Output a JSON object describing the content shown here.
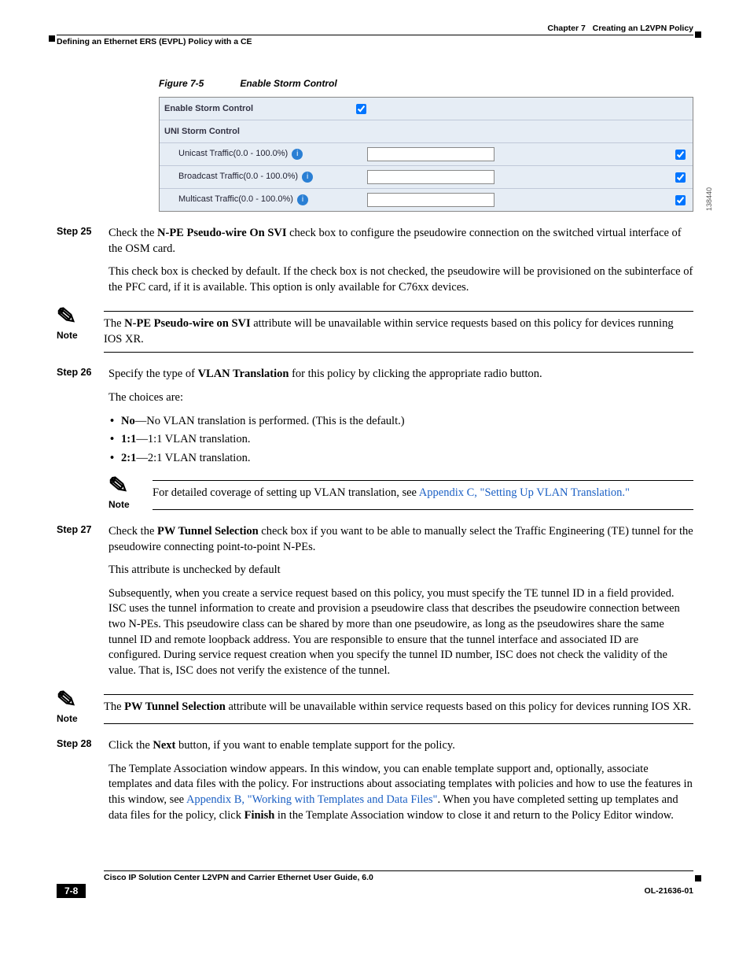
{
  "header": {
    "chapter_label": "Chapter 7",
    "chapter_title": "Creating an L2VPN Policy",
    "section": "Defining an Ethernet ERS (EVPL) Policy with a CE"
  },
  "figure": {
    "number": "Figure 7-5",
    "title": "Enable Storm Control",
    "side_code": "138440",
    "rows": {
      "enable_label": "Enable Storm Control",
      "uni_label": "UNI Storm Control",
      "unicast": "Unicast Traffic(0.0 - 100.0%)",
      "broadcast": "Broadcast Traffic(0.0 - 100.0%)",
      "multicast": "Multicast Traffic(0.0 - 100.0%)"
    }
  },
  "steps": {
    "s25": {
      "label": "Step 25",
      "p1a": "Check the ",
      "p1b": "N-PE Pseudo-wire On SVI",
      "p1c": " check box to configure the pseudowire connection on the switched virtual interface of the OSM card.",
      "p2": "This check box is checked by default. If the check box is not checked, the pseudowire will be provisioned on the subinterface of the PFC card, if it is available. This option is only available for C76xx devices."
    },
    "note1": {
      "label": "Note",
      "t1": "The ",
      "b1": "N-PE Pseudo-wire on SVI",
      "t2": " attribute will be unavailable within service requests based on this policy for devices running IOS XR."
    },
    "s26": {
      "label": "Step 26",
      "p1a": "Specify the type of ",
      "p1b": "VLAN Translation",
      "p1c": " for this policy by clicking the appropriate radio button.",
      "p2": "The choices are:",
      "b1a": "No",
      "b1b": "—No VLAN translation is performed. (This is the default.)",
      "b2a": "1:1",
      "b2b": "—1:1 VLAN translation.",
      "b3a": "2:1",
      "b3b": "—2:1 VLAN translation."
    },
    "note2": {
      "label": "Note",
      "t1": "For detailed coverage of setting up VLAN translation, see ",
      "link": "Appendix C, \"Setting Up VLAN Translation.\""
    },
    "s27": {
      "label": "Step 27",
      "p1a": "Check the ",
      "p1b": "PW Tunnel Selection",
      "p1c": " check box if you want to be able to manually select the Traffic Engineering (TE) tunnel for the pseudowire connecting point-to-point N-PEs.",
      "p2": "This attribute is unchecked by default",
      "p3": "Subsequently, when you create a service request based on this policy, you must specify the TE tunnel ID in a field provided. ISC uses the tunnel information to create and provision a pseudowire class that describes the pseudowire connection between two N-PEs. This pseudowire class can be shared by more than one pseudowire, as long as the pseudowires share the same tunnel ID and remote loopback address. You are responsible to ensure that the tunnel interface and associated ID are configured. During service request creation when you specify the tunnel ID number, ISC does not check the validity of the value. That is, ISC does not verify the existence of the tunnel."
    },
    "note3": {
      "label": "Note",
      "t1": "The ",
      "b1": "PW Tunnel Selection",
      "t2": " attribute will be unavailable within service requests based on this policy for devices running IOS XR."
    },
    "s28": {
      "label": "Step 28",
      "p1a": "Click the ",
      "p1b": "Next",
      "p1c": " button, if you want to enable template support for the policy.",
      "p2a": "The Template Association window appears. In this window, you can enable template support and, optionally, associate templates and data files with the policy. For instructions about associating templates with policies and how to use the features in this window, see ",
      "link": "Appendix B, \"Working with Templates and Data Files\"",
      "p2b": ". When you have completed setting up templates and data files for the policy, click ",
      "b2": "Finish",
      "p2c": " in the Template Association window to close it and return to the Policy Editor window."
    }
  },
  "footer": {
    "title": "Cisco IP Solution Center L2VPN and Carrier Ethernet User Guide, 6.0",
    "page": "7-8",
    "doc": "OL-21636-01"
  }
}
